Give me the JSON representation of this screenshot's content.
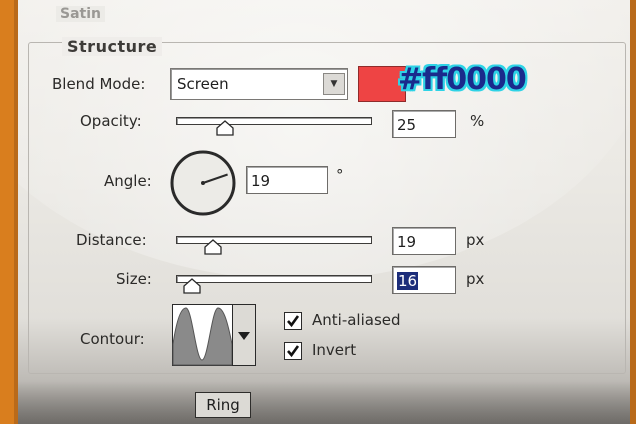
{
  "window": {
    "title": "Satin"
  },
  "structure": {
    "title": "Structure",
    "blend_mode": {
      "label": "Blend Mode:",
      "value": "Screen"
    },
    "color": {
      "swatch": "#ee4444",
      "hex_annotation": "#ff0000"
    },
    "opacity": {
      "label": "Opacity:",
      "value": "25",
      "unit": "%",
      "slider_fraction": 0.25
    },
    "angle": {
      "label": "Angle:",
      "value": "19",
      "unit": "°",
      "degrees": 19
    },
    "distance": {
      "label": "Distance:",
      "value": "19",
      "unit": "px",
      "slider_fraction": 0.19
    },
    "size": {
      "label": "Size:",
      "value": "16",
      "unit": "px",
      "slider_fraction": 0.08
    },
    "contour": {
      "label": "Contour:"
    },
    "anti_aliased": {
      "label": "Anti-aliased",
      "checked": true
    },
    "invert": {
      "label": "Invert",
      "checked": true
    }
  },
  "bottom": {
    "button_label": "Ring"
  },
  "icons": [
    "dropdown-arrow-icon",
    "slider-thumb-icon",
    "angle-dial-icon",
    "contour-curve-icon",
    "checkmark-icon"
  ]
}
